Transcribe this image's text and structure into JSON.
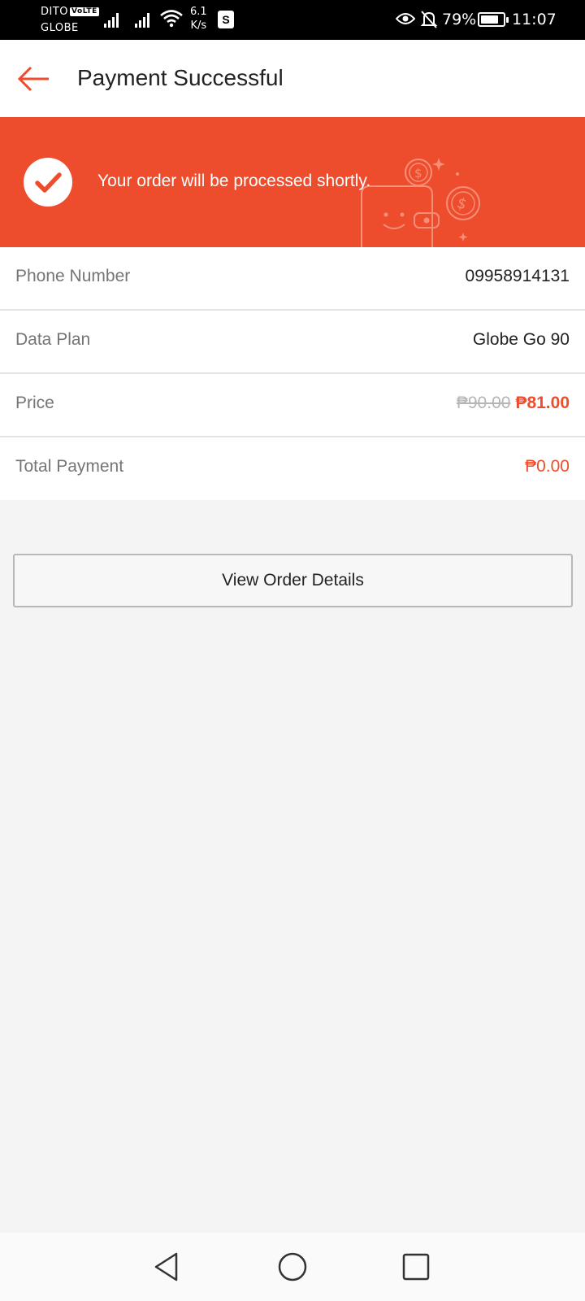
{
  "status_bar": {
    "carrier_primary": "DITO",
    "volte_badge": "VoLTE",
    "carrier_secondary": "GLOBE",
    "net_speed_value": "6.1",
    "net_speed_unit": "K/s",
    "shop_icon_letter": "S",
    "battery_percent_label": "79%",
    "battery_level": 0.79,
    "time": "11:07"
  },
  "app_bar": {
    "title": "Payment Successful",
    "back_icon": "arrow-left-icon"
  },
  "banner": {
    "message": "Your order will be processed shortly.",
    "icon": "check-circle-icon",
    "background": "#ee4d2d"
  },
  "details": {
    "phone_label": "Phone Number",
    "phone_value": "09958914131",
    "plan_label": "Data Plan",
    "plan_value": "Globe Go 90",
    "price_label": "Price",
    "price_original": "₱90.00",
    "price_discounted": "₱81.00",
    "total_label": "Total Payment",
    "total_value": "₱0.00"
  },
  "actions": {
    "view_order_label": "View Order Details"
  },
  "colors": {
    "accent": "#ee4d2d",
    "background": "#f4f4f4",
    "muted_text": "#757575"
  }
}
